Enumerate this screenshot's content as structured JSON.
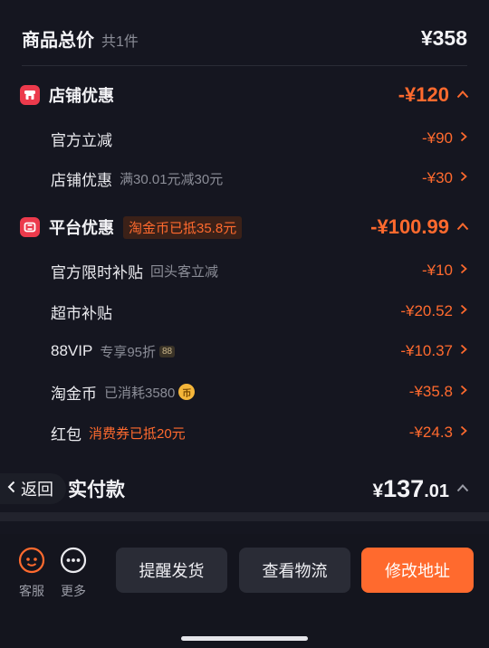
{
  "total": {
    "title": "商品总价",
    "count": "共1件",
    "price": "¥358"
  },
  "store_discount": {
    "title": "店铺优惠",
    "amount": "-¥120",
    "items": [
      {
        "label": "官方立减",
        "desc": "",
        "amount": "-¥90"
      },
      {
        "label": "店铺优惠",
        "desc": "满30.01元减30元",
        "amount": "-¥30"
      }
    ]
  },
  "platform_discount": {
    "title": "平台优惠",
    "tag": "淘金币已抵35.8元",
    "amount": "-¥100.99",
    "items": [
      {
        "label": "官方限时补贴",
        "desc": "回头客立减",
        "amount": "-¥10"
      },
      {
        "label": "超市补贴",
        "desc": "",
        "amount": "-¥20.52"
      },
      {
        "label": "88VIP",
        "desc": "专享95折",
        "badge": "88",
        "amount": "-¥10.37"
      },
      {
        "label": "淘金币",
        "desc": "已消耗3580",
        "coin": "币",
        "amount": "-¥35.8"
      },
      {
        "label": "红包",
        "desc": "消费券已抵20元",
        "amount": "-¥24.3"
      }
    ]
  },
  "payment": {
    "back_label": "返回",
    "label": "实付款",
    "yen": "¥",
    "int": "137",
    "dec": ".01"
  },
  "bottom": {
    "service_label": "客服",
    "more_label": "更多",
    "remind_label": "提醒发货",
    "logistics_label": "查看物流",
    "address_label": "修改地址"
  },
  "colors": {
    "accent": "#ff6a2e",
    "store_icon": "#ec3a4c",
    "background": "#151620"
  }
}
